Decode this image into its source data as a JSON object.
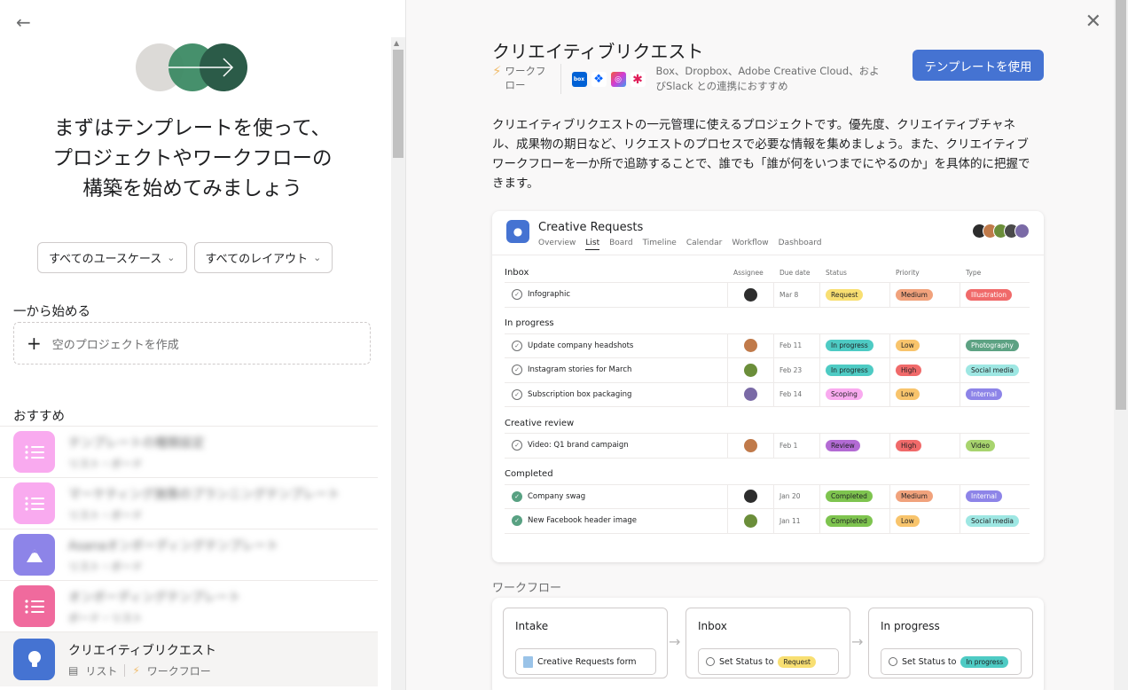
{
  "left": {
    "hero_title": "まずはテンプレートを使って、プロジェクトやワークフローの構築を始めてみましょう",
    "filter_usecase": "すべてのユースケース",
    "filter_layout": "すべてのレイアウト",
    "scratch_label": "一から始める",
    "blank_project": "空のプロジェクトを作成",
    "recommended_label": "おすすめ",
    "templates": [
      {
        "title": "テンプレートの種類設定",
        "sub": "リスト・ボード",
        "color": "#f9aaef",
        "icon": "list-icon"
      },
      {
        "title": "マーケティング施策のプランニングテンプレート",
        "sub": "リスト・ボード",
        "color": "#f9aaef",
        "icon": "list-icon"
      },
      {
        "title": "Asanaオンボーディングテンプレート",
        "sub": "リスト・ボード",
        "color": "#8d84e8",
        "icon": "mountain-icon"
      },
      {
        "title": "オンボーディングテンプレート",
        "sub": "ボード・リスト",
        "color": "#f06a9d",
        "icon": "list-icon"
      }
    ],
    "active_template": {
      "title": "クリエイティブリクエスト",
      "sub_list": "リスト",
      "sub_workflow": "ワークフロー",
      "color": "#4573d2",
      "icon": "lightbulb-icon"
    }
  },
  "right": {
    "title": "クリエイティブリクエスト",
    "workflow_tag": "ワークフロー",
    "integrations_text": "Box、Dropbox、Adobe Creative Cloud、およびSlack との連携におすすめ",
    "use_button": "テンプレートを使用",
    "description": "クリエイティブリクエストの一元管理に使えるプロジェクトです。優先度、クリエイティブチャネル、成果物の期日など、リクエストのプロセスで必要な情報を集めましょう。また、クリエイティブワークフローを一か所で追跡することで、誰でも「誰が何をいつまでにやるのか」を具体的に把握できます。",
    "preview": {
      "project_name": "Creative Requests",
      "tabs": [
        "Overview",
        "List",
        "Board",
        "Timeline",
        "Calendar",
        "Workflow",
        "Dashboard"
      ],
      "columns": {
        "assignee": "Assignee",
        "due": "Due date",
        "status": "Status",
        "priority": "Priority",
        "type": "Type"
      },
      "sections": [
        {
          "name": "Inbox",
          "rows": [
            {
              "task": "Infographic",
              "done": false,
              "av": "#2d2d2d",
              "due": "Mar 8",
              "status": "Request",
              "sc": "#f8df72",
              "priority": "Medium",
              "pc": "#f1a27c",
              "type": "Illustration",
              "tc": "#f06a6a"
            }
          ]
        },
        {
          "name": "In progress",
          "rows": [
            {
              "task": "Update company headshots",
              "done": false,
              "av": "#c07a4a",
              "due": "Feb 11",
              "status": "In progress",
              "sc": "#4ecbc4",
              "priority": "Low",
              "pc": "#f8c46c",
              "type": "Photography",
              "tc": "#5da283"
            },
            {
              "task": "Instagram stories for March",
              "done": false,
              "av": "#6b8e3a",
              "due": "Feb 23",
              "status": "In progress",
              "sc": "#4ecbc4",
              "priority": "High",
              "pc": "#f06a6a",
              "type": "Social media",
              "tc": "#9ee7e3"
            },
            {
              "task": "Subscription box packaging",
              "done": false,
              "av": "#7a6aa6",
              "due": "Feb 14",
              "status": "Scoping",
              "sc": "#f9aaef",
              "priority": "Low",
              "pc": "#f8c46c",
              "type": "Internal",
              "tc": "#8d84e8"
            }
          ]
        },
        {
          "name": "Creative review",
          "rows": [
            {
              "task": "Video: Q1 brand campaign",
              "done": false,
              "av": "#c07a4a",
              "due": "Feb 1",
              "status": "Review",
              "sc": "#b36bd4",
              "priority": "High",
              "pc": "#f06a6a",
              "type": "Video",
              "tc": "#a8d46e"
            }
          ]
        },
        {
          "name": "Completed",
          "rows": [
            {
              "task": "Company swag",
              "done": true,
              "av": "#2d2d2d",
              "due": "Jan 20",
              "status": "Completed",
              "sc": "#7ec44f",
              "priority": "Medium",
              "pc": "#f1a27c",
              "type": "Internal",
              "tc": "#8d84e8"
            },
            {
              "task": "New Facebook header image",
              "done": true,
              "av": "#6b8e3a",
              "due": "Jan 11",
              "status": "Completed",
              "sc": "#7ec44f",
              "priority": "Low",
              "pc": "#f8c46c",
              "type": "Social media",
              "tc": "#9ee7e3"
            }
          ]
        }
      ]
    },
    "workflow_label": "ワークフロー",
    "workflow": {
      "intake_title": "Intake",
      "intake_item": "Creative Requests form",
      "inbox_title": "Inbox",
      "inbox_prefix": "Set Status to",
      "inbox_pill": "Request",
      "progress_title": "In progress",
      "progress_prefix": "Set Status to",
      "progress_pill": "In progress"
    }
  },
  "colors": {
    "accent": "#4573d2",
    "green_dark": "#2b5b48",
    "green_mid": "#3c8a64",
    "bolt": "#f1bd6c"
  }
}
